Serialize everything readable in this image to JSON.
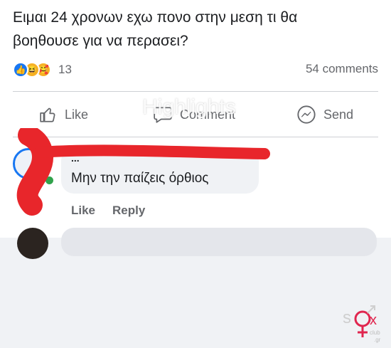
{
  "post": {
    "text_line1": "Ειμαι 24 χρονων εχω πονο στην μεση τι θα",
    "text_line2": "βοηθουσε για να περασει?"
  },
  "reactions": {
    "icons": [
      "like-reaction",
      "haha-reaction",
      "care-reaction"
    ],
    "count": "13",
    "comments": "54 comments"
  },
  "actions": {
    "like": "Like",
    "comment": "Comment",
    "send": "Send"
  },
  "overlay_watermark": "Highlights",
  "comment": {
    "author": "...",
    "text": "Μην την παίζεις όρθιος",
    "like": "Like",
    "reply": "Reply"
  },
  "colors": {
    "accent": "#1877f2",
    "scribble": "#e8262b",
    "muted_text": "#65676b",
    "bubble": "#f0f2f5"
  },
  "logo": {
    "text": "sex club .gr"
  }
}
